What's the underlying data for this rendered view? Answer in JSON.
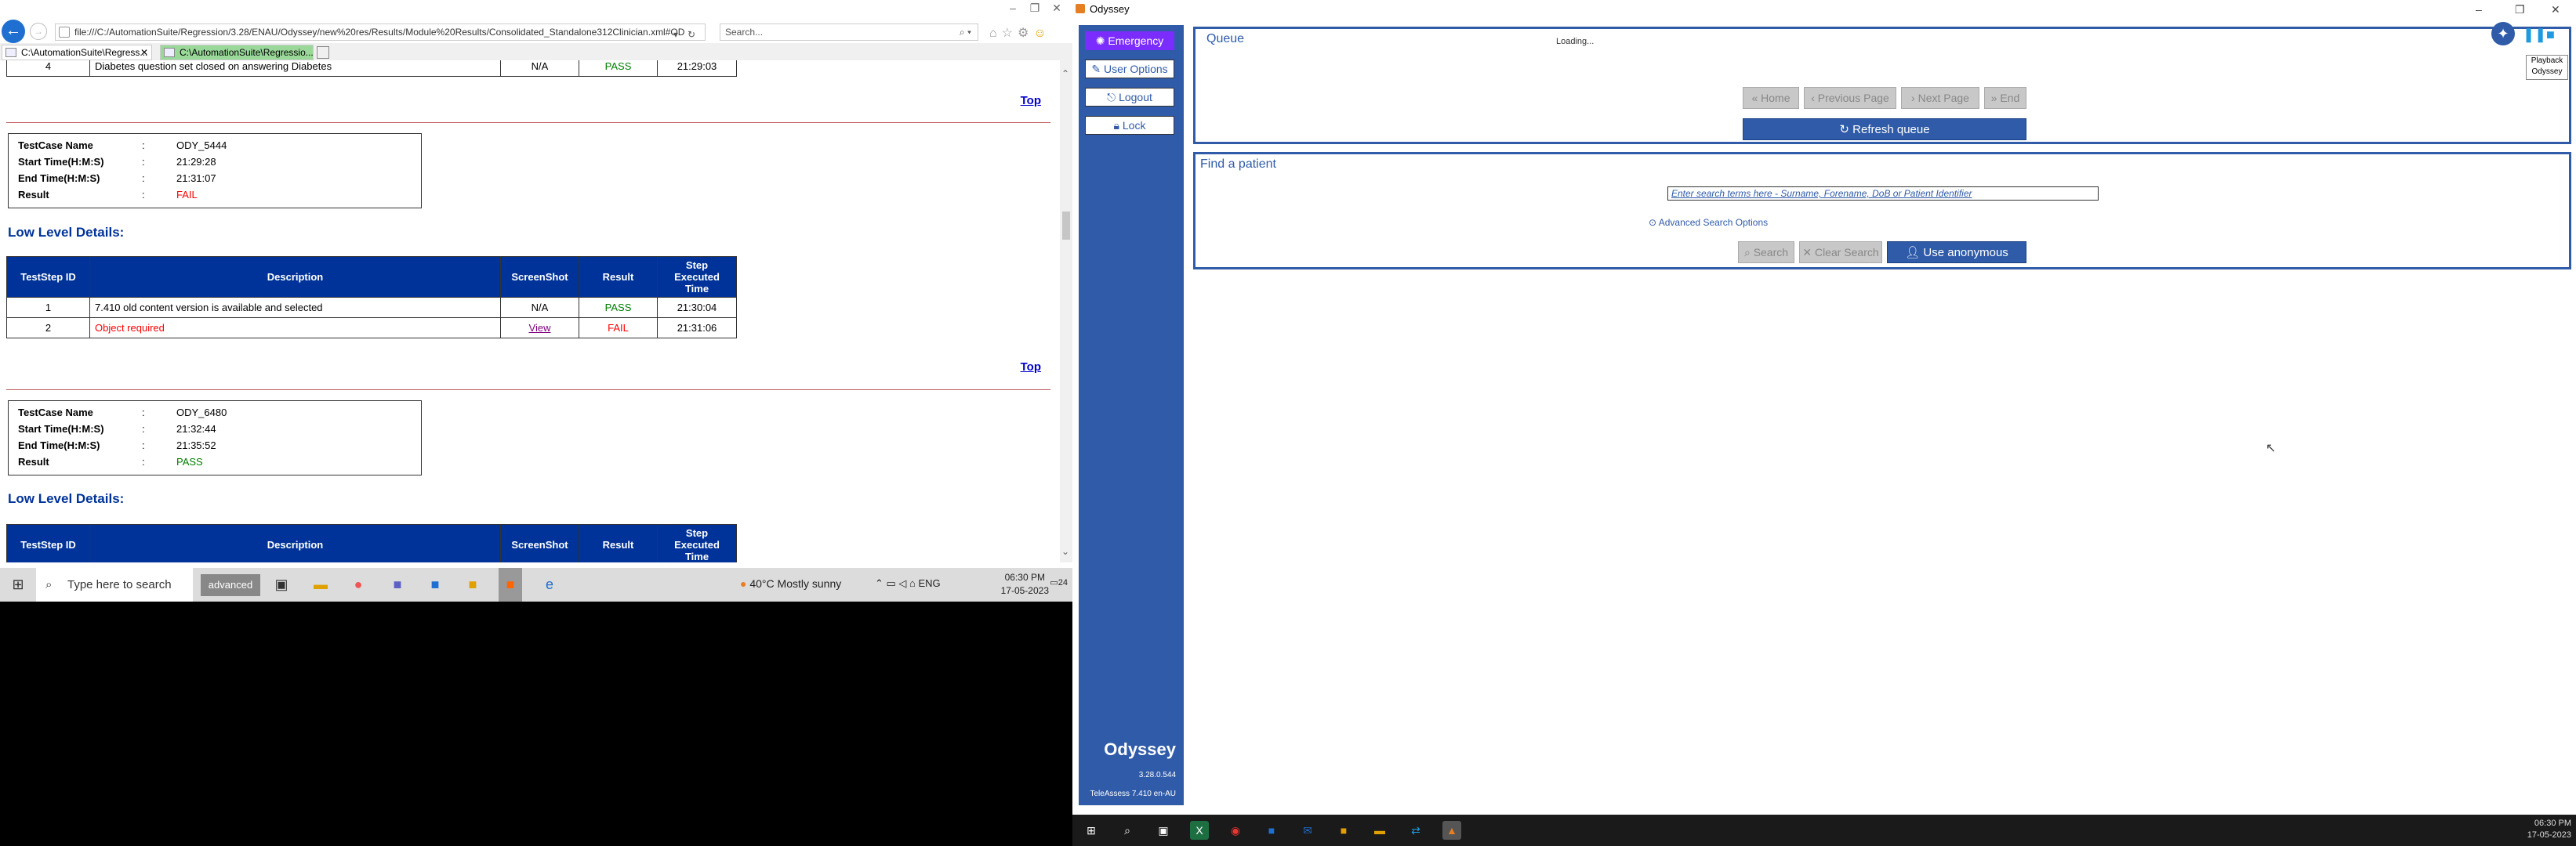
{
  "browser": {
    "address": "file:///C:/AutomationSuite/Regression/3.28/ENAU/Odyssey/new%20res/Results/Module%20Results/Consolidated_Standalone312Clinician.xml#OD",
    "search_placeholder": "Search...",
    "tabs": [
      "C:\\AutomationSuite\\Regress...",
      "C:\\AutomationSuite\\Regressio..."
    ]
  },
  "report": {
    "top_row": {
      "id": "4",
      "desc": "Diabetes question set closed on answering Diabetes",
      "shot": "N/A",
      "result": "PASS",
      "time": "21:29:03"
    },
    "top_link": "Top",
    "labels": {
      "name": "TestCase Name",
      "start": "Start Time(H:M:S)",
      "end": "End Time(H:M:S)",
      "result": "Result",
      "colon": ":"
    },
    "low_level": "Low Level Details:",
    "headers": {
      "id": "TestStep ID",
      "desc": "Description",
      "shot": "ScreenShot",
      "result": "Result",
      "time": "Step Executed Time"
    },
    "case1": {
      "name": "ODY_5444",
      "start": "21:29:28",
      "end": "21:31:07",
      "result": "FAIL",
      "steps": [
        {
          "id": "1",
          "desc": "7.410 old content version is available and selected",
          "shot": "N/A",
          "result": "PASS",
          "time": "21:30:04"
        },
        {
          "id": "2",
          "desc": "Object required",
          "shot": "View",
          "result": "FAIL",
          "time": "21:31:06"
        }
      ]
    },
    "case2": {
      "name": "ODY_6480",
      "start": "21:32:44",
      "end": "21:35:52",
      "result": "PASS"
    }
  },
  "taskbar1": {
    "search": "Type here to search",
    "weather": "40°C  Mostly sunny",
    "lang": "ENG",
    "time": "06:30 PM",
    "date": "17-05-2023",
    "badge": "24",
    "advanced": "advanced"
  },
  "odyssey": {
    "title": "Odyssey",
    "sidebar": {
      "emergency": "Emergency",
      "user_options": "User Options",
      "logout": "Logout",
      "lock": "Lock",
      "brand": "Odyssey",
      "version": "3.28.0.544",
      "teleassess": "TeleAssess 7.410 en-AU"
    },
    "queue": {
      "title": "Queue",
      "loading": "Loading...",
      "home": "Home",
      "prev": "Previous Page",
      "next": "Next Page",
      "end": "End",
      "refresh": "Refresh queue"
    },
    "find": {
      "title": "Find a patient",
      "placeholder": "Enter search terms here - Surname, Forename, DoB or Patient Identifier",
      "advanced": "Advanced Search Options",
      "search": "Search",
      "clear": "Clear Search",
      "anon": "Use anonymous patient"
    },
    "playback": {
      "line1": "Playback",
      "line2": "Odyssey"
    }
  },
  "taskbar2": {
    "time": "06:30 PM",
    "date": "17-05-2023"
  }
}
